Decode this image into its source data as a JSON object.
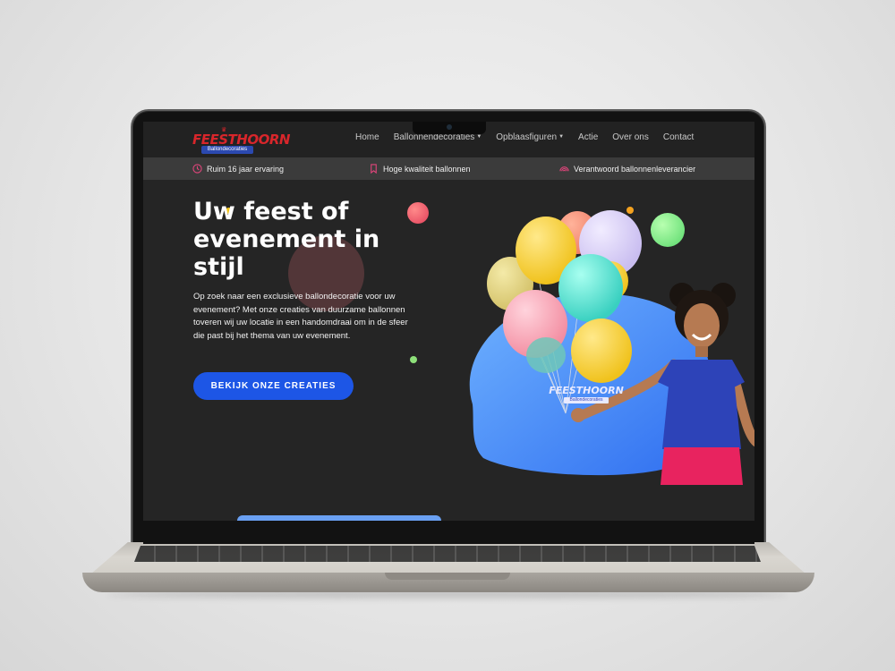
{
  "nav": {
    "logo_text": "FEESTHOORN",
    "logo_subtitle": "Ballondecoraties",
    "items": [
      {
        "label": "Home",
        "dropdown": false
      },
      {
        "label": "Ballonnendecoraties",
        "dropdown": true
      },
      {
        "label": "Opblaasfiguren",
        "dropdown": true
      },
      {
        "label": "Actie",
        "dropdown": false
      },
      {
        "label": "Over ons",
        "dropdown": false
      },
      {
        "label": "Contact",
        "dropdown": false
      }
    ]
  },
  "usp_bar": {
    "items": [
      {
        "icon": "clock-icon",
        "label": "Ruim 16 jaar ervaring"
      },
      {
        "icon": "bookmark-icon",
        "label": "Hoge kwaliteit ballonnen"
      },
      {
        "icon": "rainbow-icon",
        "label": "Verantwoord ballonnenleverancier"
      }
    ]
  },
  "hero": {
    "title": "Uw feest of evenement in stijl",
    "text": "Op zoek naar een exclusieve ballondecoratie voor uw evenement? Met onze creaties van duurzame ballonnen toveren wij uw locatie in een handomdraai om in de sfeer die past bij het thema van uw evenement.",
    "cta_label": "BEKIJK ONZE CREATIES",
    "shirt_text": "FEESTHOORN",
    "shirt_subtext": "Ballondecoraties"
  },
  "colors": {
    "background": "#252525",
    "nav": "#222222",
    "usp_bar": "#3b3b3b",
    "accent": "#1d56e6",
    "brand_red": "#d8262b",
    "icon_pink": "#e0457b"
  }
}
